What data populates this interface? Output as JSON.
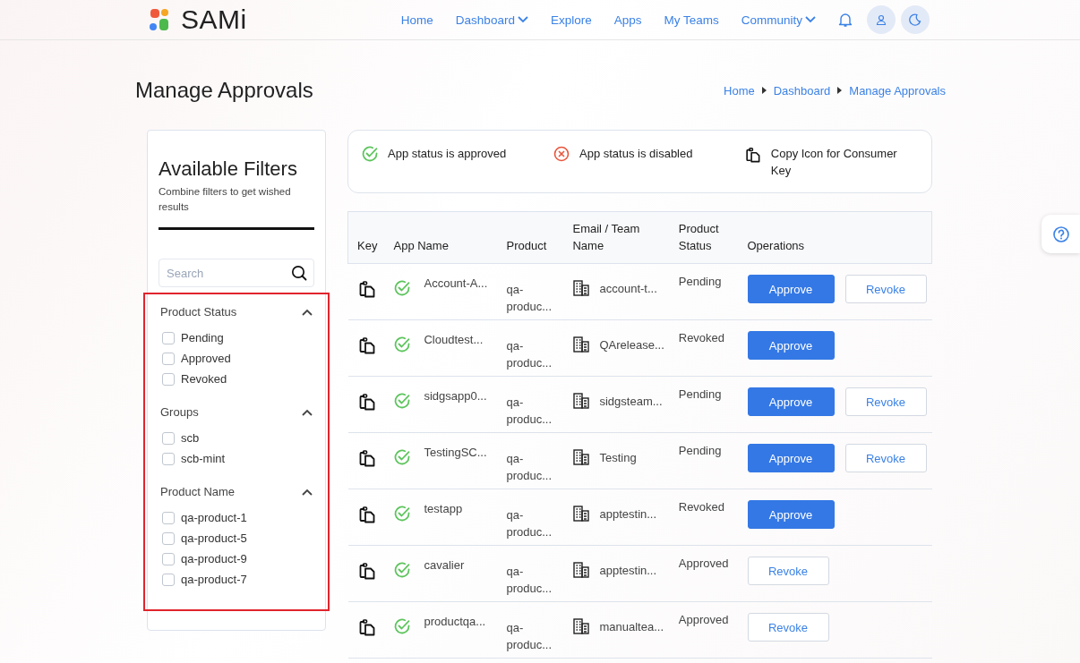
{
  "header": {
    "logo": "SAMi",
    "nav": [
      {
        "label": "Home",
        "dropdown": false
      },
      {
        "label": "Dashboard",
        "dropdown": true
      },
      {
        "label": "Explore",
        "dropdown": false
      },
      {
        "label": "Apps",
        "dropdown": false
      },
      {
        "label": "My Teams",
        "dropdown": false
      },
      {
        "label": "Community",
        "dropdown": true
      }
    ]
  },
  "page": {
    "title": "Manage Approvals",
    "breadcrumb": [
      "Home",
      "Dashboard",
      "Manage Approvals"
    ]
  },
  "filters": {
    "title": "Available Filters",
    "subtitle": "Combine filters to get wished results",
    "search": {
      "placeholder": "Search"
    },
    "highlighted": true,
    "groups": [
      {
        "title": "Product Status",
        "expanded": true,
        "options": [
          {
            "label": "Pending",
            "checked": false
          },
          {
            "label": "Approved",
            "checked": false
          },
          {
            "label": "Revoked",
            "checked": false
          }
        ]
      },
      {
        "title": "Groups",
        "expanded": true,
        "options": [
          {
            "label": "scb",
            "checked": false
          },
          {
            "label": "scb-mint",
            "checked": false
          }
        ]
      },
      {
        "title": "Product Name",
        "expanded": true,
        "options": [
          {
            "label": "qa-product-1",
            "checked": false
          },
          {
            "label": "qa-product-5",
            "checked": false
          },
          {
            "label": "qa-product-9",
            "checked": false
          },
          {
            "label": "qa-product-7",
            "checked": false
          }
        ]
      }
    ]
  },
  "legend": [
    {
      "kind": "approved",
      "label": "App status is approved"
    },
    {
      "kind": "disabled",
      "label": "App status is disabled"
    },
    {
      "kind": "copy",
      "label": "Copy Icon for Consumer Key"
    }
  ],
  "table": {
    "columns": [
      "Key",
      "App Name",
      "Product",
      "Email / Team Name",
      "Product Status",
      "Operations"
    ],
    "rows": [
      {
        "app_name": "Account-A...",
        "product": "qa-produc...",
        "team": "account-t...",
        "product_status": "Pending",
        "operations": [
          {
            "kind": "approve",
            "label": "Approve"
          },
          {
            "kind": "revoke",
            "label": "Revoke"
          }
        ]
      },
      {
        "app_name": "Cloudtest...",
        "product": "qa-produc...",
        "team": "QArelease...",
        "product_status": "Revoked",
        "operations": [
          {
            "kind": "approve",
            "label": "Approve"
          }
        ]
      },
      {
        "app_name": "sidgsapp0...",
        "product": "qa-produc...",
        "team": "sidgsteam...",
        "product_status": "Pending",
        "operations": [
          {
            "kind": "approve",
            "label": "Approve"
          },
          {
            "kind": "revoke",
            "label": "Revoke"
          }
        ]
      },
      {
        "app_name": "TestingSC...",
        "product": "qa-produc...",
        "team": "Testing",
        "product_status": "Pending",
        "operations": [
          {
            "kind": "approve",
            "label": "Approve"
          },
          {
            "kind": "revoke",
            "label": "Revoke"
          }
        ]
      },
      {
        "app_name": "testapp",
        "product": "qa-produc...",
        "team": "apptestin...",
        "product_status": "Revoked",
        "operations": [
          {
            "kind": "approve",
            "label": "Approve"
          }
        ]
      },
      {
        "app_name": "cavalier",
        "product": "qa-produc...",
        "team": "apptestin...",
        "product_status": "Approved",
        "operations": [
          {
            "kind": "revoke",
            "label": "Revoke"
          }
        ]
      },
      {
        "app_name": "productqa...",
        "product": "qa-produc...",
        "team": "manualtea...",
        "product_status": "Approved",
        "operations": [
          {
            "kind": "revoke",
            "label": "Revoke"
          }
        ]
      }
    ]
  }
}
